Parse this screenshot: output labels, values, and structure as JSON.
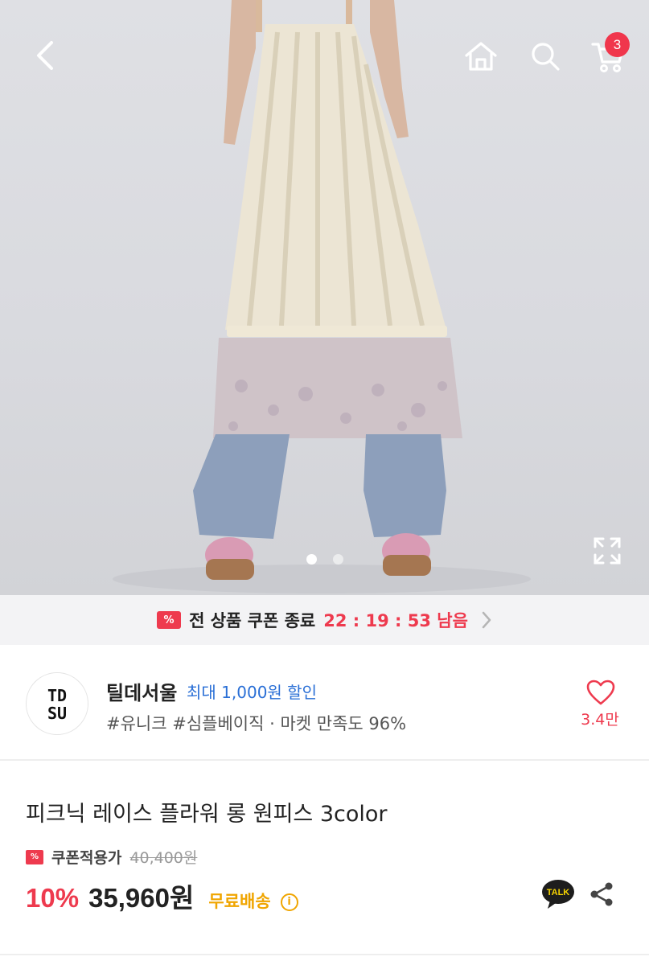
{
  "header": {
    "back_icon": "chevron-left-icon",
    "home_icon": "home-icon",
    "search_icon": "search-icon",
    "cart_icon": "cart-icon",
    "cart_count": "3"
  },
  "gallery": {
    "page_count": 2,
    "current_page": 1,
    "expand_icon": "expand-icon"
  },
  "coupon_banner": {
    "label": "전 상품 쿠폰 종료",
    "countdown": "22 : 19 : 53 남음",
    "icon": "coupon-icon"
  },
  "shop": {
    "logo_text_top": "TD",
    "logo_text_bottom": "SU",
    "name": "틸데서울",
    "discount": "최대 1,000원 할인",
    "tags": "#유니크 #심플베이직 · 마켓 만족도 96%",
    "favorite_count": "3.4만"
  },
  "product": {
    "title": "피크닉 레이스 플라워 롱 원피스 3color",
    "coupon_label": "쿠폰적용가",
    "original_price": "40,400원",
    "discount_rate": "10%",
    "sale_price": "35,960원",
    "shipping": "무료배송",
    "talk_label": "TALK"
  },
  "colors": {
    "accent_red": "#ee3a4e",
    "link_blue": "#2a6fd6",
    "free_ship_yellow": "#f0a500"
  }
}
